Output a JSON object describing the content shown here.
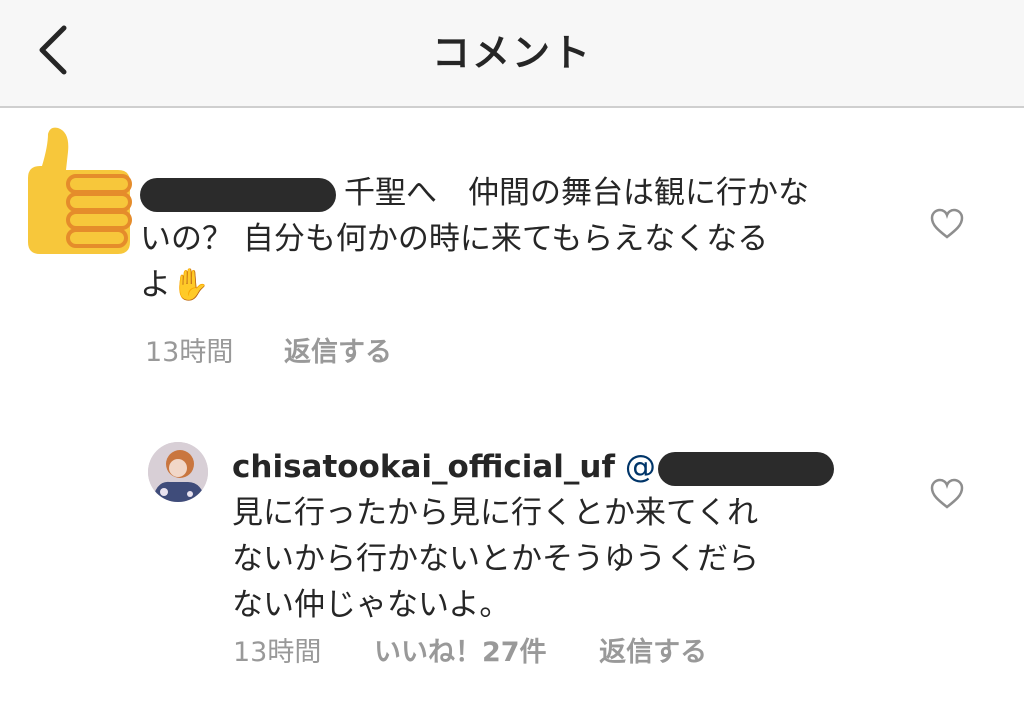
{
  "header": {
    "title": "コメント"
  },
  "comment1": {
    "prefix_text": "千聖へ　仲間の舞台は観に行かな",
    "line2": "いの？ 自分も何かの時に来てもらえなくなる",
    "line3": "よ",
    "emoji": "✋",
    "time": "13時間",
    "reply": "返信する"
  },
  "comment2": {
    "username": "chisatookai_official_uf",
    "mention_prefix": "@",
    "line1": "見に行ったから見に行くとか来てくれ",
    "line2": "ないから行かないとかそうゆうくだら",
    "line3": "ない仲じゃないよ。",
    "time": "13時間",
    "likes": "いいね！27件",
    "reply": "返信する"
  },
  "icons": {
    "back": "chevron-left-icon",
    "like": "heart-outline-icon",
    "thumbs_up": "thumbs-up-emoji"
  }
}
